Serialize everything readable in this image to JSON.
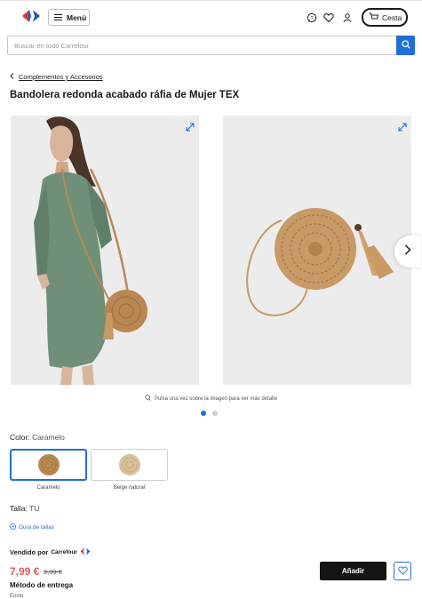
{
  "header": {
    "menu_label": "Menú",
    "cart_label": "Cesta",
    "icons": [
      "carrefour-logo",
      "chat-icon",
      "heart-icon",
      "user-icon",
      "cart-icon"
    ]
  },
  "search": {
    "placeholder": "Buscar en todo Carrefour",
    "value": ""
  },
  "breadcrumb": {
    "label": "Complementos y Accesorios"
  },
  "product": {
    "title": "Bandolera redonda acabado ráfia de Mujer TEX",
    "gallery_hint": "Pulsa una vez sobre la imagen para ver más detalle",
    "color_label": "Color:",
    "color_value": "Caramelo",
    "colors": [
      {
        "name": "Caramelo",
        "hex": "#b98752",
        "selected": true
      },
      {
        "name": "Beige natural",
        "hex": "#d9c09a",
        "selected": false
      }
    ],
    "size_label": "Talla:",
    "size_value": "TU",
    "size_guide": "Guía de tallas",
    "sold_by_label": "Vendido por",
    "sold_by_brand": "Carrefour",
    "price": "7,99 €",
    "old_price": "9,99 €",
    "delivery_label": "Método de entrega",
    "delivery_sub": "Envío",
    "add_label": "Añadir"
  },
  "colors": {
    "accent": "#1e6fd6",
    "price": "#e25a5a",
    "button_dark": "#141414"
  }
}
